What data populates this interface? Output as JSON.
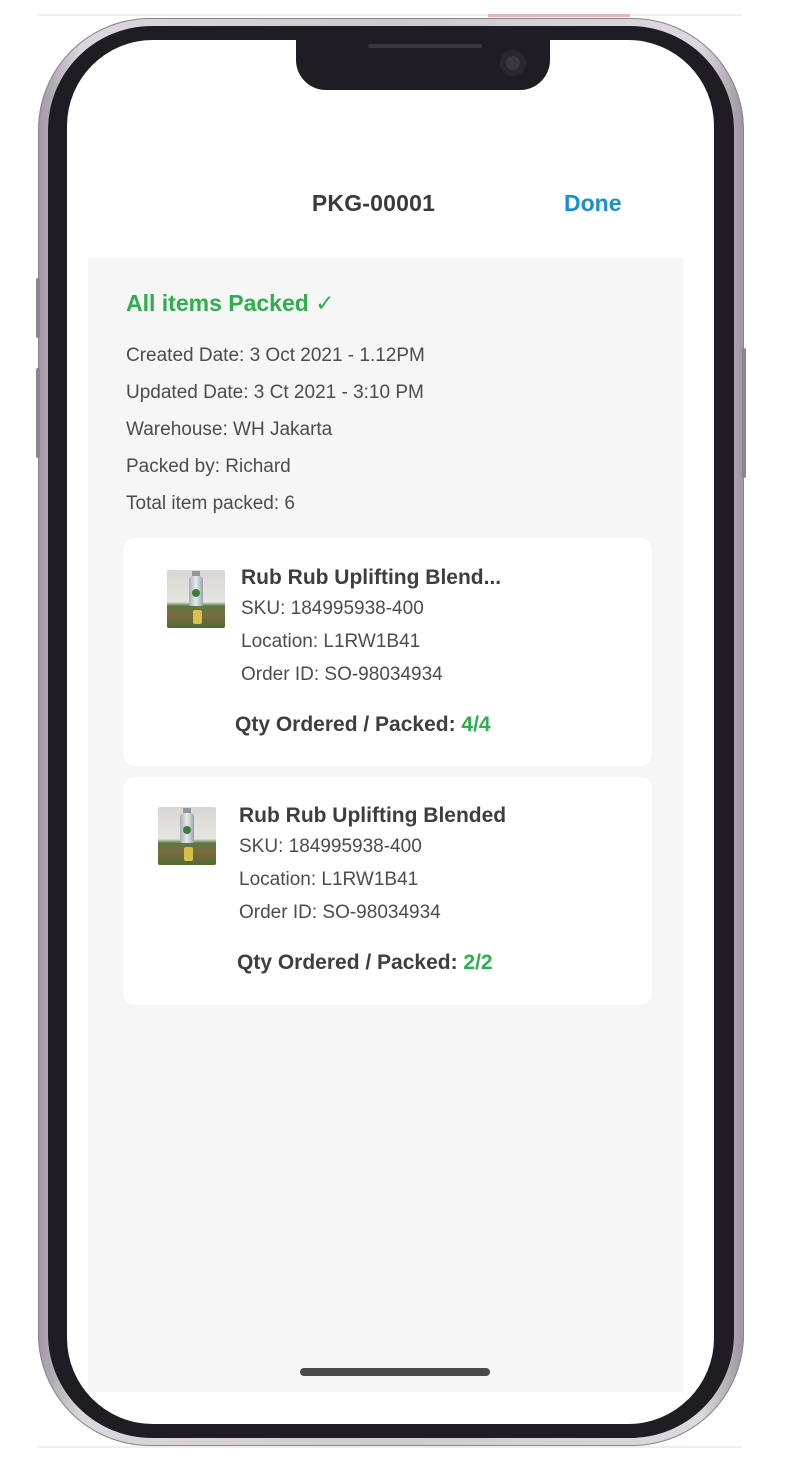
{
  "header": {
    "title": "PKG-00001",
    "done_label": "Done"
  },
  "summary": {
    "status": "All items Packed ✓",
    "created": "Created Date: 3 Oct 2021 - 1.12PM",
    "updated": "Updated Date: 3 Ct 2021 - 3:10 PM",
    "warehouse": "Warehouse: WH Jakarta",
    "packed_by": "Packed by:  Richard",
    "total": "Total item packed: 6"
  },
  "items": [
    {
      "name": "Rub Rub Uplifting Blend...",
      "sku": "SKU: 184995938-400",
      "location": "Location: L1RW1B41",
      "order_id": "Order ID: SO-98034934",
      "qty_label": "Qty Ordered / Packed: ",
      "qty_value": "4/4"
    },
    {
      "name": "Rub Rub Uplifting Blended",
      "sku": "SKU: 184995938-400",
      "location": "Location: L1RW1B41",
      "order_id": "Order ID: SO-98034934",
      "qty_label": "Qty Ordered / Packed: ",
      "qty_value": "2/2"
    }
  ],
  "colors": {
    "accent_green": "#2fae4e",
    "accent_blue": "#1a8fd0",
    "panel_bg": "#f6f6f6",
    "text_primary": "#3e3e40"
  },
  "icons": {
    "status_check": "check-icon",
    "product_thumb": "product-photo"
  }
}
